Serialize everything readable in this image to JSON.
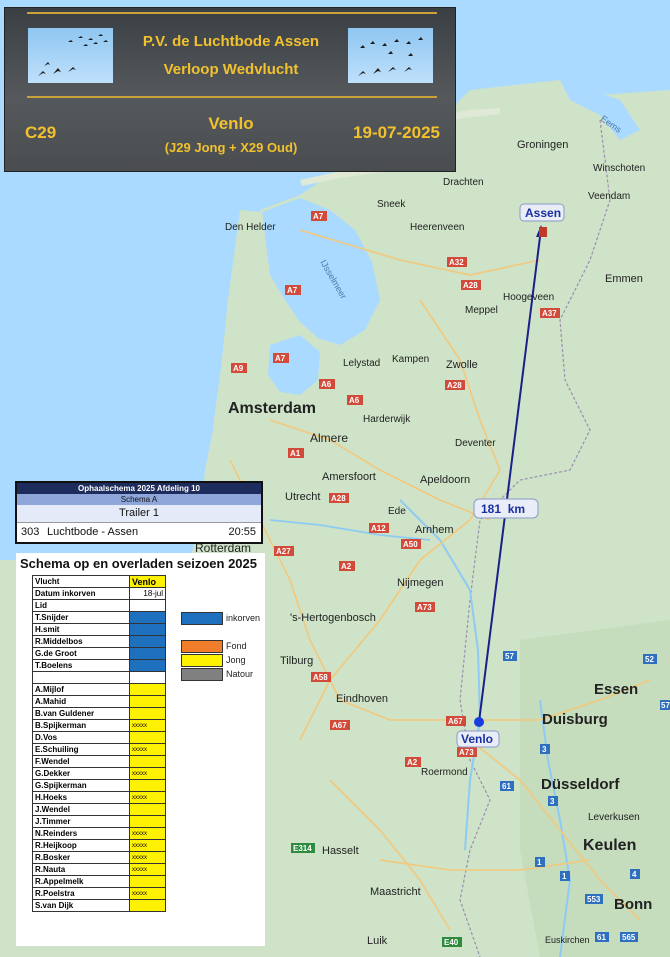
{
  "header": {
    "club": "P.V. de Luchtbode Assen",
    "subtitle": "Verloop Wedvlucht",
    "code": "C29",
    "race": "Venlo",
    "classes": "(J29 Jong + X29 Oud)",
    "date": "19-07-2025"
  },
  "route": {
    "start": "Venlo",
    "finish": "Assen",
    "distance": "181  km",
    "color": "#1b1f8a"
  },
  "map_labels": {
    "cities": [
      "Groningen",
      "Drachten",
      "Winschoten",
      "Sneek",
      "Heerenveen",
      "Veendam",
      "Den Helder",
      "Emmen",
      "Meppel",
      "Hoogeveen",
      "Lelystad",
      "Kampen",
      "Zwolle",
      "Harderwijk",
      "Amsterdam",
      "Almere",
      "Amersfoort",
      "Apeldoorn",
      "Deventer",
      "Utrecht",
      "Ede",
      "Arnhem",
      "Nijmegen",
      "'s-Hertogenbosch",
      "Tilburg",
      "Eindhoven",
      "Essen",
      "Duisburg",
      "Düsseldorf",
      "Roermond",
      "Leverkusen",
      "Keulen",
      "Hasselt",
      "Maastricht",
      "Bonn",
      "Luik",
      "Euskirchen",
      "Rotterdam",
      "Eems",
      "IJsselmeer"
    ],
    "roads": [
      "A7",
      "A7",
      "A32",
      "A28",
      "A37",
      "A7",
      "A9",
      "A6",
      "A28",
      "A1",
      "A6",
      "A28",
      "A12",
      "A50",
      "A27",
      "A2",
      "A73",
      "A58",
      "A67",
      "A2",
      "A67",
      "A73",
      "E314",
      "E40",
      "57",
      "52",
      "61",
      "3",
      "1",
      "4",
      "553",
      "565",
      "61",
      "1",
      "57",
      "3"
    ]
  },
  "schedule": {
    "title": "Ophaalschema 2025 Afdeling 10",
    "schema": "Schema A",
    "trailer": "Trailer 1",
    "number": "303",
    "name": "Luchtbode - Assen",
    "time": "20:55"
  },
  "season": {
    "title": "Schema op en overladen seizoen 2025",
    "header": {
      "label": "Vlucht",
      "value": "Venlo"
    },
    "date_row": {
      "label": "Datum inkorven",
      "value": "18-jul"
    },
    "lid_label": "Lid",
    "legend": [
      {
        "label": "inkorven",
        "color": "#1f6fbf"
      },
      {
        "label": "Fond",
        "color": "#f07d2a"
      },
      {
        "label": "Jong",
        "color": "#fff200"
      },
      {
        "label": "Natour",
        "color": "#808080"
      }
    ],
    "inkorven_members": [
      "T.Snijder",
      "H.smit",
      "R.Middelbos",
      "G.de Groot",
      "T.Boelens"
    ],
    "jong_members": [
      {
        "name": "A.Mijlof",
        "mark": ""
      },
      {
        "name": "A.Mahid",
        "mark": ""
      },
      {
        "name": "B.van Guldener",
        "mark": ""
      },
      {
        "name": "B.Spijkerman",
        "mark": "xxxxx"
      },
      {
        "name": "D.Vos",
        "mark": ""
      },
      {
        "name": "E.Schuiling",
        "mark": "xxxxx"
      },
      {
        "name": "F.Wendel",
        "mark": ""
      },
      {
        "name": "G.Dekker",
        "mark": "xxxxx"
      },
      {
        "name": "G.Spijkerman",
        "mark": ""
      },
      {
        "name": "H.Hoeks",
        "mark": "xxxxx"
      },
      {
        "name": "J.Wendel",
        "mark": ""
      },
      {
        "name": "J.Timmer",
        "mark": ""
      },
      {
        "name": "N.Reinders",
        "mark": "xxxxx"
      },
      {
        "name": "R.Heijkoop",
        "mark": "xxxxx"
      },
      {
        "name": "R.Bosker",
        "mark": "xxxxx"
      },
      {
        "name": "R.Nauta",
        "mark": "xxxxx"
      },
      {
        "name": "R.Appelmelk",
        "mark": ""
      },
      {
        "name": "R.Poelstra",
        "mark": "xxxxx"
      },
      {
        "name": "S.van Dijk",
        "mark": ""
      }
    ]
  }
}
